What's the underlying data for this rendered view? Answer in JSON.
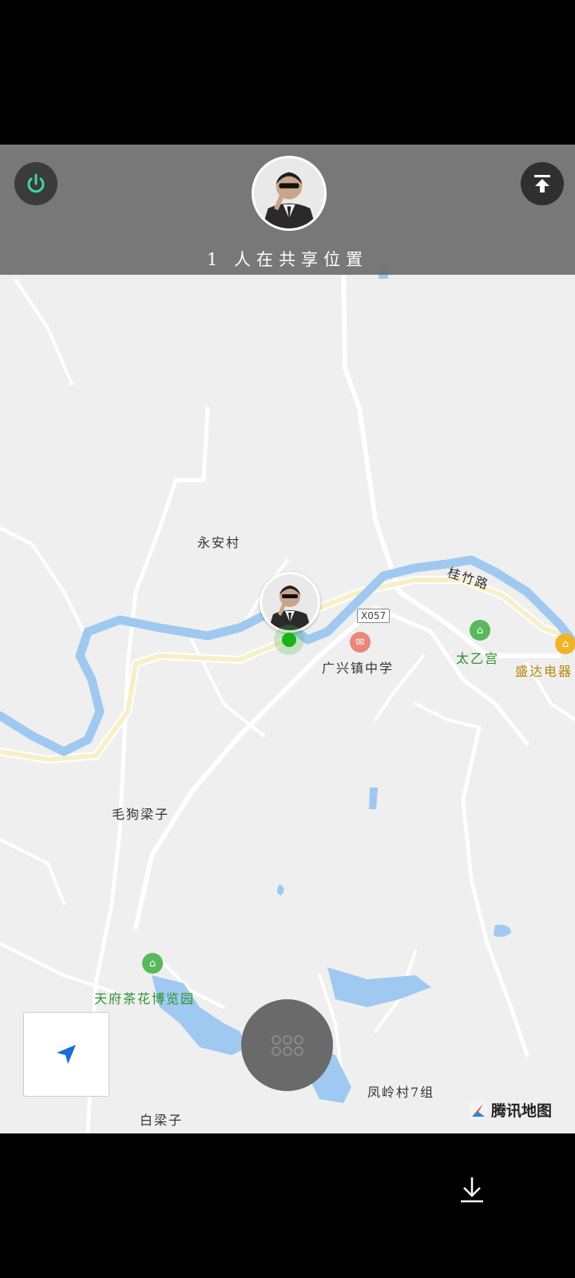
{
  "header": {
    "share_status": "1 人在共享位置",
    "power_icon": "power-icon",
    "collapse_icon": "collapse-up-icon",
    "accent_color": "#3fd6a0"
  },
  "map": {
    "labels": {
      "village_yongan": "永安村",
      "road_guizhu": "桂竹路",
      "road_code": "X057",
      "school": "广兴镇中学",
      "temple": "太乙宫",
      "store": "盛达电器",
      "maogou": "毛狗梁子",
      "museum": "天府茶花博览园",
      "fengling": "凤岭村7组",
      "bailiang": "白梁子"
    },
    "attribution": "腾讯地图",
    "water_color": "#9fc9f0",
    "road_color": "#fbf6de"
  },
  "controls": {
    "locate_icon": "navigation-arrow-icon",
    "center_icon": "microphone-grid-icon"
  },
  "bottom": {
    "download_icon": "download-icon"
  }
}
